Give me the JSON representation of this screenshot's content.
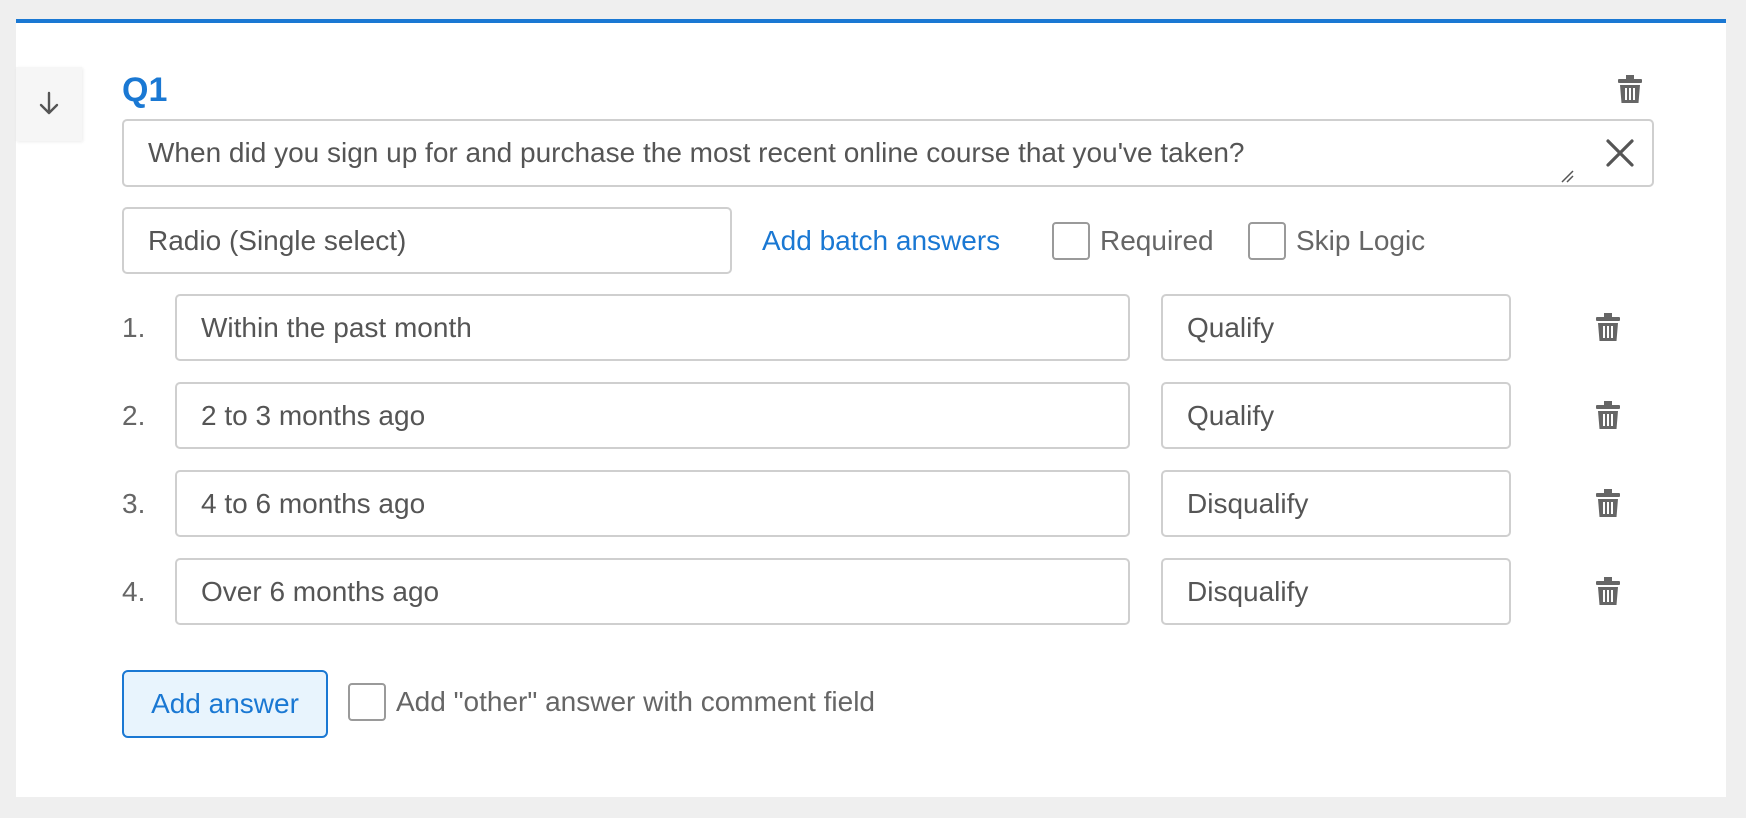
{
  "question": {
    "number": "Q1",
    "text": "When did you sign up for and purchase the most recent online course that you've taken?",
    "type": "Radio (Single select)",
    "batch_link": "Add batch answers",
    "required_label": "Required",
    "required_checked": false,
    "skip_logic_label": "Skip Logic",
    "skip_logic_checked": false
  },
  "answers": [
    {
      "num": "1.",
      "text": "Within the past month",
      "qualify": "Qualify"
    },
    {
      "num": "2.",
      "text": "2 to 3 months ago",
      "qualify": "Qualify"
    },
    {
      "num": "3.",
      "text": "4 to 6 months ago",
      "qualify": "Disqualify"
    },
    {
      "num": "4.",
      "text": "Over 6 months ago",
      "qualify": "Disqualify"
    }
  ],
  "footer": {
    "add_answer_label": "Add answer",
    "other_label": "Add \"other\" answer with comment field",
    "other_checked": false
  },
  "icons": {
    "drag": "arrow-down-icon",
    "delete": "trash-icon",
    "clear": "close-icon"
  },
  "colors": {
    "accent": "#1a78d3",
    "accent_bg": "#e8f4fd",
    "border": "#cfcfcf",
    "text": "#555555",
    "icon": "#666666"
  }
}
